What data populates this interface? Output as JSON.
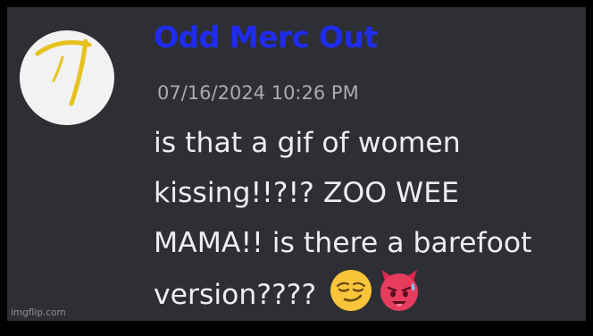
{
  "message": {
    "author": "Odd Merc Out",
    "author_color": "#1f2cf0",
    "timestamp": "07/16/2024 10:26 PM",
    "timestamp_color": "#a9abb1",
    "text_color": "#eceef2",
    "lines": [
      "is that a gif of women",
      "kissing!!?!? ZOO WEE",
      "MAMA!! is there a barefoot",
      "version????"
    ],
    "emojis": [
      "smirking-face",
      "hot-face-devil"
    ]
  },
  "avatar": {
    "background": "#f2f2f2",
    "glyph_color": "#e6c31c"
  },
  "watermark": {
    "text": "imgflip.com",
    "color": "#8e8e8e"
  }
}
